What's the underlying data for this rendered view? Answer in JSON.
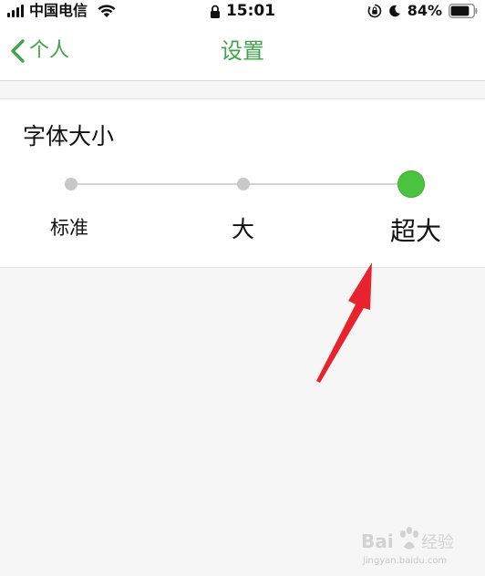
{
  "status_bar": {
    "carrier": "中国电信",
    "time": "15:01",
    "battery_percent": "84%",
    "battery_level": 0.84,
    "icons": [
      "signal-icon",
      "wifi-icon",
      "lock-icon",
      "rotation-lock-icon",
      "moon-icon",
      "battery-icon"
    ]
  },
  "nav": {
    "back_label": "个人",
    "title": "设置"
  },
  "font_size": {
    "title": "字体大小",
    "options": [
      "标准",
      "大",
      "超大"
    ],
    "selected": "超大",
    "selected_index": 2
  },
  "watermark": {
    "logo_text": "Bai 经验",
    "url": "jingyan.baidu.com"
  },
  "colors": {
    "accent": "#3fa44b",
    "slider_thumb": "#4cc241",
    "annotation_arrow": "#e8232d",
    "background": "#f6f6f6"
  }
}
